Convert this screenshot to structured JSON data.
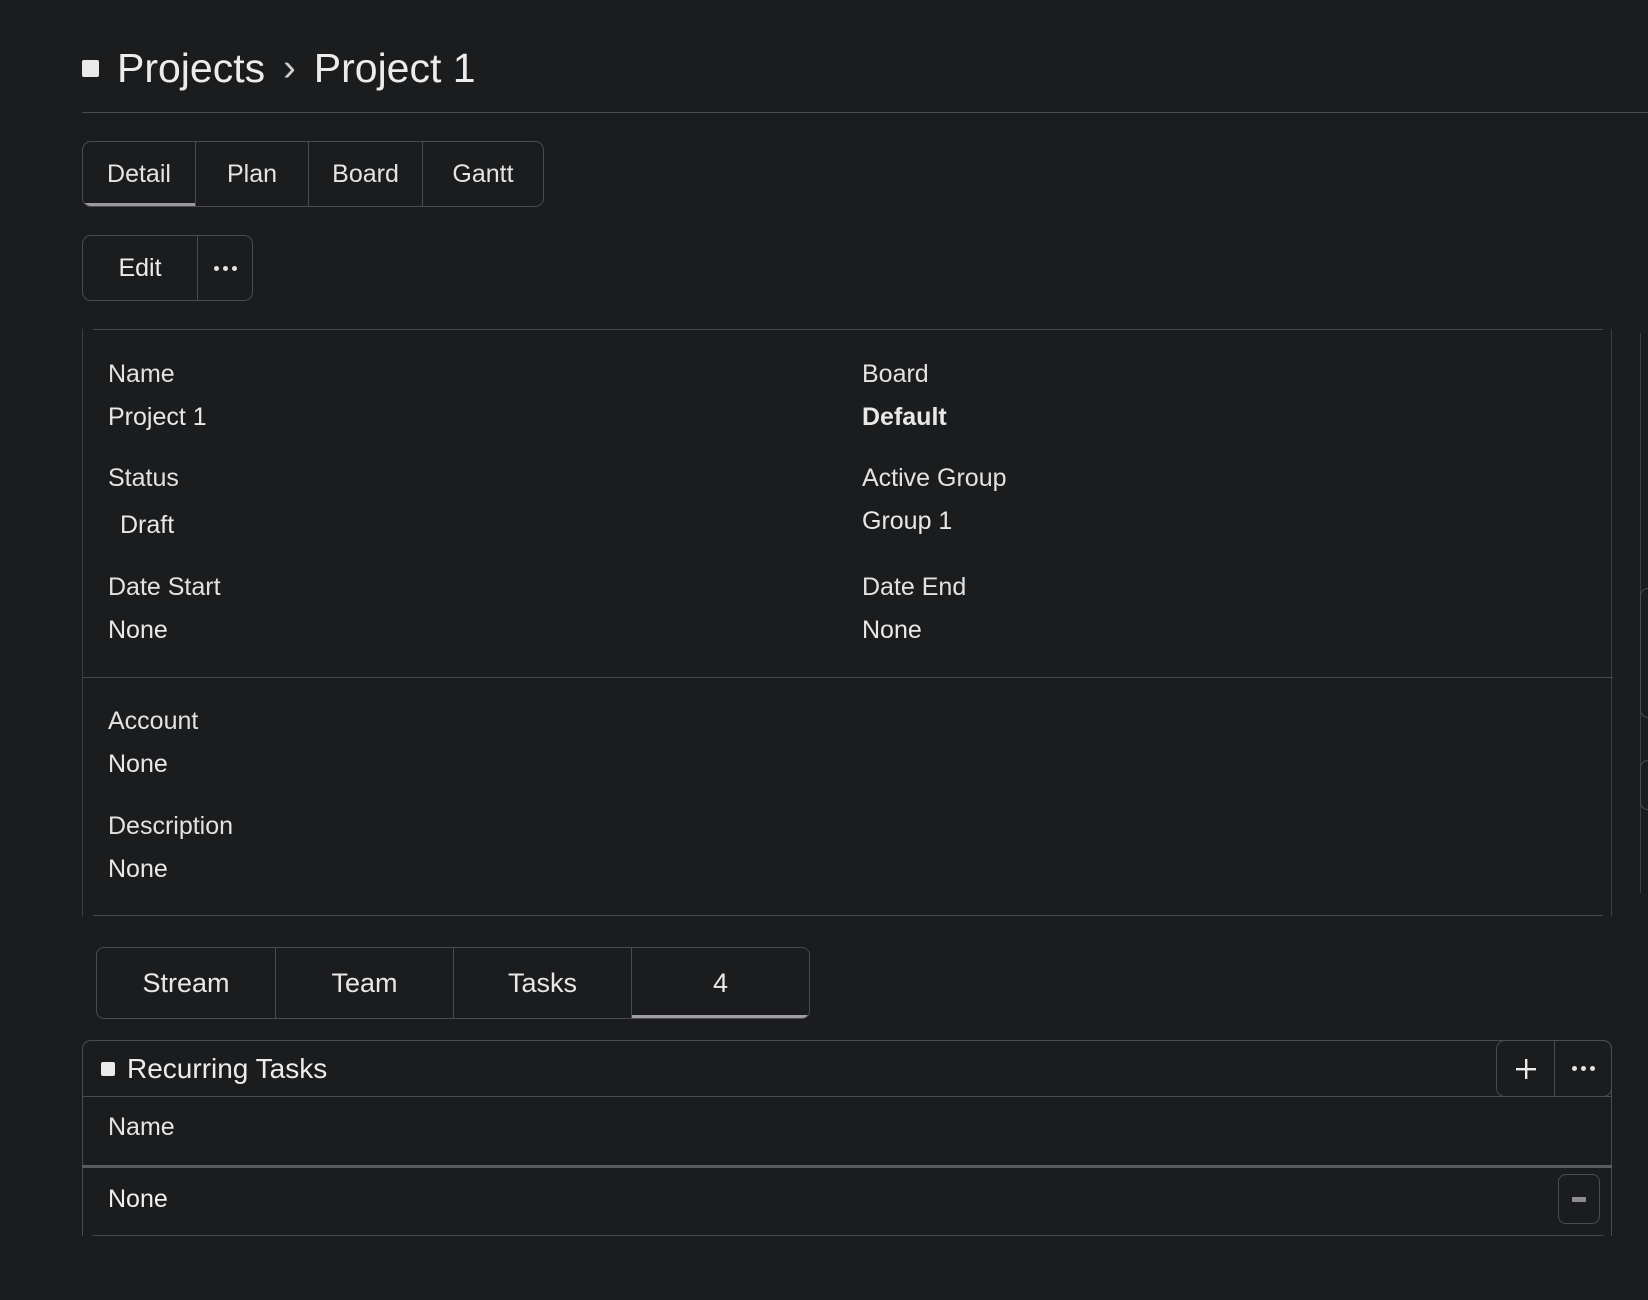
{
  "breadcrumb": {
    "root": "Projects",
    "separator": "›",
    "current": "Project 1"
  },
  "view_tabs": [
    {
      "label": "Detail",
      "active": true
    },
    {
      "label": "Plan",
      "active": false
    },
    {
      "label": "Board",
      "active": false
    },
    {
      "label": "Gantt",
      "active": false
    }
  ],
  "actions": {
    "edit_label": "Edit",
    "more_icon": "dots-horizontal-icon"
  },
  "detail": {
    "name": {
      "label": "Name",
      "value": "Project 1"
    },
    "board": {
      "label": "Board",
      "value": "Default"
    },
    "status": {
      "label": "Status",
      "value": "Draft"
    },
    "active_group": {
      "label": "Active Group",
      "value": "Group 1"
    },
    "date_start": {
      "label": "Date Start",
      "value": "None"
    },
    "date_end": {
      "label": "Date End",
      "value": "None"
    },
    "account": {
      "label": "Account",
      "value": "None"
    },
    "description": {
      "label": "Description",
      "value": "None"
    }
  },
  "bottom_tabs": [
    {
      "label": "Stream",
      "active": false
    },
    {
      "label": "Team",
      "active": false
    },
    {
      "label": "Tasks",
      "active": false
    },
    {
      "label": "4",
      "active": true
    }
  ],
  "recurring_tasks": {
    "title": "Recurring Tasks",
    "add_icon": "plus-icon",
    "more_icon": "dots-horizontal-icon",
    "columns": [
      "Name"
    ],
    "rows": [
      {
        "name": "None"
      }
    ]
  },
  "colors": {
    "background": "#1b1c1e",
    "text": "#e9e9ea",
    "border": "#4b4c50"
  }
}
